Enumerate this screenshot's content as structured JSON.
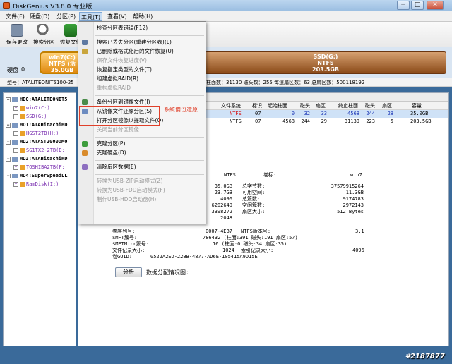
{
  "window": {
    "title": "DiskGenius V3.8.0 专业版",
    "btn_min": "─",
    "btn_max": "□",
    "btn_close": "✕"
  },
  "menu": {
    "file": "文件(F)",
    "disk": "硬盘(D)",
    "partition": "分区(P)",
    "tools": "工具(T)",
    "view": "查看(V)",
    "help": "帮助(H)"
  },
  "toolbar": {
    "save": "保存更改",
    "search": "搜索分区",
    "recover": "恢复文件"
  },
  "diskmap": {
    "disk_label": "硬盘",
    "disk_num": "0",
    "part_c": {
      "name": "win7(C:)",
      "fs": "NTFS (活",
      "size": "35.0GB"
    },
    "part_g": {
      "name": "SSD(G:)",
      "fs": "NTFS",
      "size": "203.5GB"
    },
    "model_left": "型号：ATALITEONIT5100-25",
    "model_right": "柱面数：31130  磁头数：255  每道扇区数：63  总扇区数：500118192"
  },
  "tree": {
    "items": [
      {
        "kind": "disk",
        "text": "HD0:ATALITEONIT5"
      },
      {
        "kind": "part",
        "text": "win7(C:)"
      },
      {
        "kind": "part",
        "text": "SSD(G:)"
      },
      {
        "kind": "disk",
        "text": "HD1:ATAHitachiHD"
      },
      {
        "kind": "part",
        "text": "HGST2TB(H:)"
      },
      {
        "kind": "disk",
        "text": "HD2:ATAST2000DM0"
      },
      {
        "kind": "part",
        "text": "SG1TX2-2TB(D:"
      },
      {
        "kind": "disk",
        "text": "HD3:ATAHitachiHD"
      },
      {
        "kind": "part",
        "text": "TOSHIBA2TB(F:"
      },
      {
        "kind": "disk",
        "text": "HD4:SuperSpeedLL"
      },
      {
        "kind": "part",
        "text": "RamDisk(I:)"
      }
    ]
  },
  "table": {
    "headers": [
      "文件系统",
      "标识",
      "起始柱面",
      "磁头",
      "扇区",
      "终止柱面",
      "磁头",
      "扇区",
      "容量"
    ],
    "rows": [
      [
        "NTFS",
        "07",
        "0",
        "32",
        "33",
        "4568",
        "244",
        "28",
        "35.0GB"
      ],
      [
        "NTFS",
        "07",
        "4568",
        "244",
        "29",
        "31130",
        "223",
        "5",
        "203.5GB"
      ]
    ]
  },
  "info": {
    "fs_value": "NTFS",
    "vol_label": "卷标:",
    "vol_value": "win7",
    "left_values": [
      "35.0GB",
      "23.7GB",
      "4096",
      "6202640",
      "T3398272",
      "2048"
    ],
    "right_labels": [
      "总字节数:",
      "可用空间:",
      "总簇数:",
      "空闲簇数:",
      "扇区大小:"
    ],
    "right_values": [
      "37579915264",
      "11.3GB",
      "9174783",
      "2972143",
      "512 Bytes"
    ],
    "serial_label": "卷序列号:",
    "serial_value": "0007-4EB7",
    "ntfs_ver_label": "NTFS版本号:",
    "ntfs_ver_value": "3.1",
    "mft_label": "$MFT簇号:",
    "mft_value": "786432 (柱面:391 磁头:191 扇区:57)",
    "mftmirr_label": "$MFTMirr簇号:",
    "mftmirr_value": "16 (柱面:0 磁头:34 扇区:35)",
    "record_label": "文件记录大小:",
    "record_value": "1024",
    "index_label": "索引记录大小:",
    "index_value": "4096",
    "guid_label": "卷GUID:",
    "guid_value": "0522A2ED-22BB-4877-AD6E-105415A9D15E"
  },
  "analyze": {
    "button": "分析",
    "label": "数据分配情况图:"
  },
  "dropdown": {
    "items": [
      {
        "text": "检查分区表错误(F12)",
        "enabled": true
      },
      {
        "sep": true
      },
      {
        "text": "搜索已丢失分区(重建分区表)(L)",
        "enabled": true
      },
      {
        "text": "已删除或格式化后的文件恢复(U)",
        "enabled": true
      },
      {
        "text": "保存文件恢复进度(V)",
        "enabled": false
      },
      {
        "text": "恢复指定类型的文件(T)",
        "enabled": true
      },
      {
        "text": "组建虚拟RAID(R)",
        "enabled": true
      },
      {
        "text": "重构虚拟RAID",
        "enabled": false
      },
      {
        "sep": true
      },
      {
        "text": "备份分区到镜像文件(I)",
        "enabled": true
      },
      {
        "text": "从镜像文件还原分区(S)",
        "enabled": true
      },
      {
        "text": "打开分区镜像以提取文件(O)",
        "enabled": true
      },
      {
        "text": "关闭当前分区镜像",
        "enabled": false
      },
      {
        "sep": true
      },
      {
        "text": "克隆分区(P)",
        "enabled": true
      },
      {
        "text": "克隆硬盘(D)",
        "enabled": true
      },
      {
        "sep": true
      },
      {
        "text": "清除扇区数据(E)",
        "enabled": true
      },
      {
        "sep": true
      },
      {
        "text": "转换为USB-ZIP启动模式(Z)",
        "enabled": false
      },
      {
        "text": "转换为USB-FDD启动模式(F)",
        "enabled": false
      },
      {
        "text": "制作USB-HDD启动盘(H)",
        "enabled": false
      }
    ],
    "annotation": "系統備份還原"
  },
  "watermark": "#2187877",
  "colors": {
    "accent": "#7fa8d6",
    "annotation": "#e0402a",
    "partition_c": "#e08a10",
    "partition_g": "#8a4a18"
  }
}
